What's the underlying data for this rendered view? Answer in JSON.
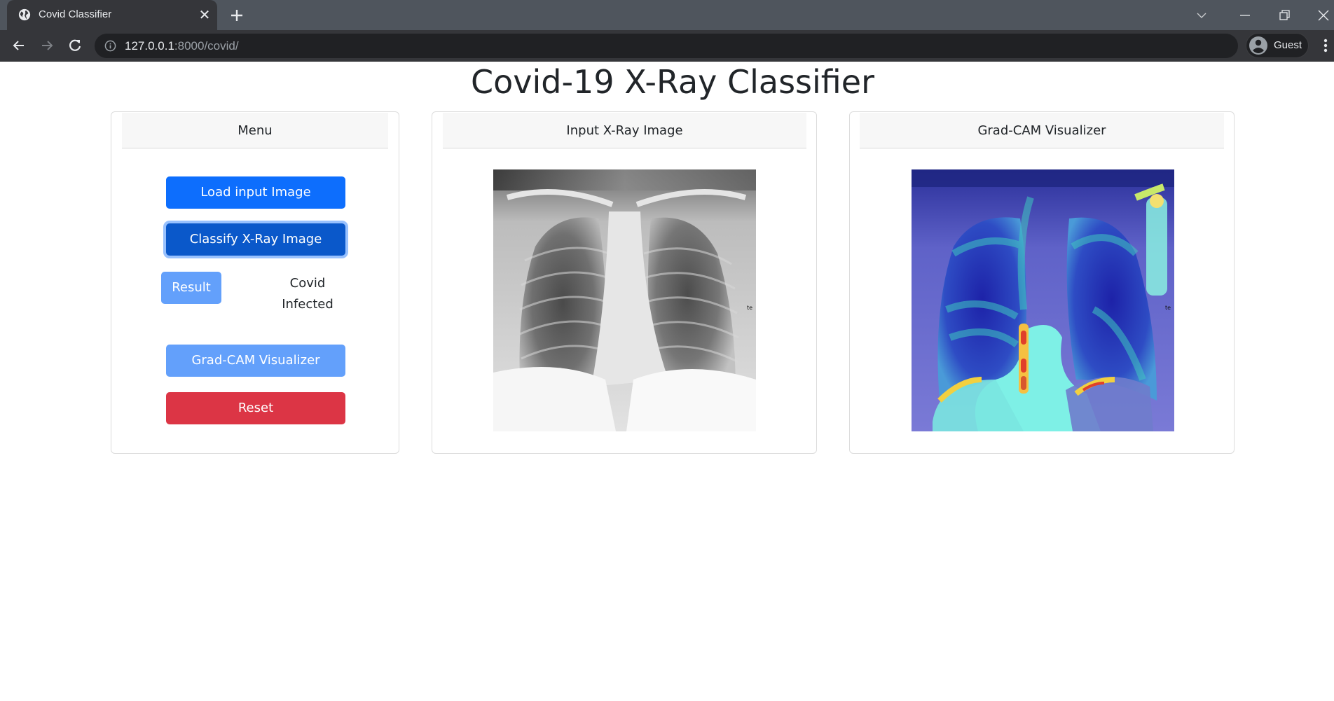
{
  "browser": {
    "tab_title": "Covid Classifier",
    "tab_favicon": "globe-icon",
    "close_tab_icon": "close-icon",
    "new_tab_icon": "plus-icon",
    "url_host": "127.0.0.1",
    "url_rest": ":8000/covid/",
    "site_info_icon": "info-icon",
    "profile_label": "Guest",
    "profile_icon": "account-circle-icon",
    "menu_icon": "kebab-menu-icon",
    "nav_icons": [
      "back-arrow-icon",
      "forward-arrow-icon",
      "reload-icon"
    ],
    "window_controls": [
      "tab-search-icon",
      "minimize-icon",
      "restore-icon",
      "close-window-icon"
    ]
  },
  "page": {
    "title": "Covid-19 X-Ray Classifier"
  },
  "menu_card": {
    "header": "Menu",
    "load_button": "Load input Image",
    "classify_button": "Classify X-Ray Image",
    "result_button": "Result",
    "result_value_line1": "Covid",
    "result_value_line2": "Infected",
    "gradcam_button": "Grad-CAM Visualizer",
    "reset_button": "Reset"
  },
  "input_card": {
    "header": "Input X-Ray Image",
    "image_alt": "Chest X-ray input image"
  },
  "gradcam_card": {
    "header": "Grad-CAM Visualizer",
    "image_alt": "Grad-CAM heatmap overlay on chest X-ray"
  },
  "colors": {
    "primary": "#0d6efd",
    "primary_active": "#0a58ca",
    "primary_disabled": "#63a0fb",
    "danger": "#dc3545",
    "chrome_dark": "#35363a",
    "chrome_tabstrip": "#4f555d"
  }
}
